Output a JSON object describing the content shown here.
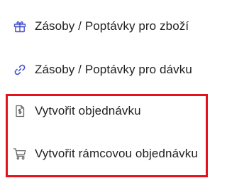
{
  "menu": {
    "items": [
      {
        "label": "Zásoby / Poptávky pro zboží",
        "icon": "gift-icon"
      },
      {
        "label": "Zásoby / Poptávky pro dávku",
        "icon": "link-icon"
      },
      {
        "label": "Vytvořit objednávku",
        "icon": "document-dollar-icon"
      },
      {
        "label": "Vytvořit rámcovou objednávku",
        "icon": "shopping-cart-icon"
      }
    ]
  },
  "colors": {
    "accent_icon": "#4a55c9",
    "neutral_icon": "#666666",
    "text": "#1f1f1f",
    "highlight": "#e3131b"
  }
}
